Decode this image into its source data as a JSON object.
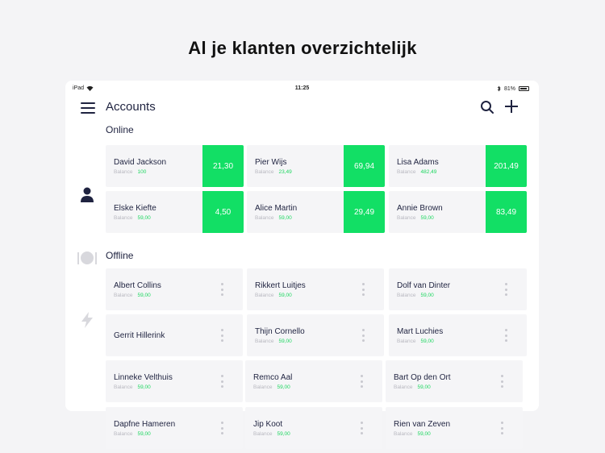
{
  "headline": "Al je klanten overzichtelijk",
  "statusbar": {
    "device": "iPad",
    "time": "11:25",
    "battery": "81%",
    "battery_level": 0.81
  },
  "navbar": {
    "title": "Accounts"
  },
  "sections": {
    "online": "Online",
    "offline": "Offline"
  },
  "balance_label": "Balance",
  "online_accounts": [
    {
      "name": "David Jackson",
      "balance": "100",
      "amount": "21,30"
    },
    {
      "name": "Pier Wijs",
      "balance": "23,49",
      "amount": "69,94"
    },
    {
      "name": "Lisa Adams",
      "balance": "482,49",
      "amount": "201,49"
    },
    {
      "name": "Elske Kiefte",
      "balance": "59,00",
      "amount": "4,50"
    },
    {
      "name": "Alice Martin",
      "balance": "59,00",
      "amount": "29,49"
    },
    {
      "name": "Annie Brown",
      "balance": "59,00",
      "amount": "83,49"
    }
  ],
  "offline_accounts": [
    {
      "name": "Albert Collins",
      "balance": "59,00"
    },
    {
      "name": "Rikkert Luitjes",
      "balance": "59,00"
    },
    {
      "name": "Dolf van Dinter",
      "balance": "59,00"
    },
    {
      "name": "Gerrit Hillerink",
      "balance": ""
    },
    {
      "name": "Thijn Cornello",
      "balance": "59,00"
    },
    {
      "name": "Mart Luchies",
      "balance": "59,00"
    },
    {
      "name": "Linneke Velthuis",
      "balance": "59,00"
    },
    {
      "name": "Remco Aal",
      "balance": "59,00"
    },
    {
      "name": "Bart Op den Ort",
      "balance": "59,00"
    },
    {
      "name": "Dapfne Hameren",
      "balance": "59,00"
    },
    {
      "name": "Jip Koot",
      "balance": "59,00"
    },
    {
      "name": "Rien van Zeven",
      "balance": "59,00"
    }
  ],
  "colors": {
    "accent_green": "#12df65",
    "balance_green": "#1ed760",
    "text_dark": "#1f2340",
    "card_bg": "#f5f5f7"
  },
  "icons": [
    "menu-icon",
    "search-icon",
    "plus-icon",
    "person-icon",
    "dining-icon",
    "lightning-icon",
    "wifi-icon",
    "bluetooth-icon",
    "battery-icon"
  ]
}
